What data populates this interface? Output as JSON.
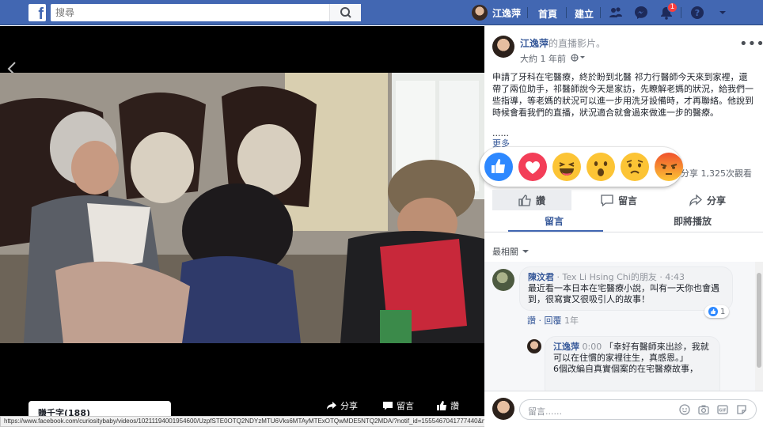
{
  "header": {
    "search_placeholder": "搜尋",
    "user_name": "江逸萍",
    "home_label": "首頁",
    "create_label": "建立",
    "notification_count": "1",
    "brand_color": "#4267b2"
  },
  "video": {
    "title_tab": "賺千字(188)",
    "share_label": "分享",
    "comment_label": "留言",
    "like_label": "讚"
  },
  "status_url": "https://www.facebook.com/curiositybaby/videos/10211194001954600/UzpfSTE0OTQ2NDYzMTU6Vks6MTAyMTExOTQwMDE5NTQ2MDA/?notif_id=1555467041777440&notif_t=story_reshare#",
  "post": {
    "author": "江逸萍",
    "author_suffix": "的直播影片",
    "dot": "。",
    "time": "大約 1 年前",
    "privacy_icon": "globe-icon",
    "text": "申請了牙科在宅醫療，終於盼到北醫 祁力行醫師今天來到家裡，還帶了兩位助手，祁醫師說今天是家訪，先瞭解老媽的狀況，給我們一些指導，等老媽的狀況可以進一步用洗牙設備時，才再聯絡。他說到時候會看我們的直播，狀況適合就會過來做進一步的醫療。",
    "ellipsis": "......",
    "more_label": "更多",
    "stats": "分享 1,325次觀看",
    "reactions": [
      "like",
      "love",
      "haha",
      "wow",
      "sad",
      "angry"
    ],
    "actions": {
      "like": "讚",
      "comment": "留言",
      "share": "分享"
    }
  },
  "tabs": {
    "comments": "留言",
    "upnext": "即將播放"
  },
  "sort_label": "最相關",
  "comments": [
    {
      "name": "陳汶君",
      "meta": "· Tex Li Hsing Chi的朋友 · 4:43",
      "text": "最近看一本日本在宅醫療小說，叫有一天你也會遇到，很寫實又很吸引人的故事！",
      "like_action": "讚",
      "reply_action": "回覆",
      "age": "1年",
      "like_count": "1"
    },
    {
      "name": "江逸萍",
      "meta": "0:00",
      "text": "「幸好有醫師來出診，我就可以在住慣的家裡往生，真感恩。」",
      "text2": "6個改編自真實個案的在宅醫療故事，"
    }
  ],
  "composer": {
    "placeholder": "留言......"
  }
}
